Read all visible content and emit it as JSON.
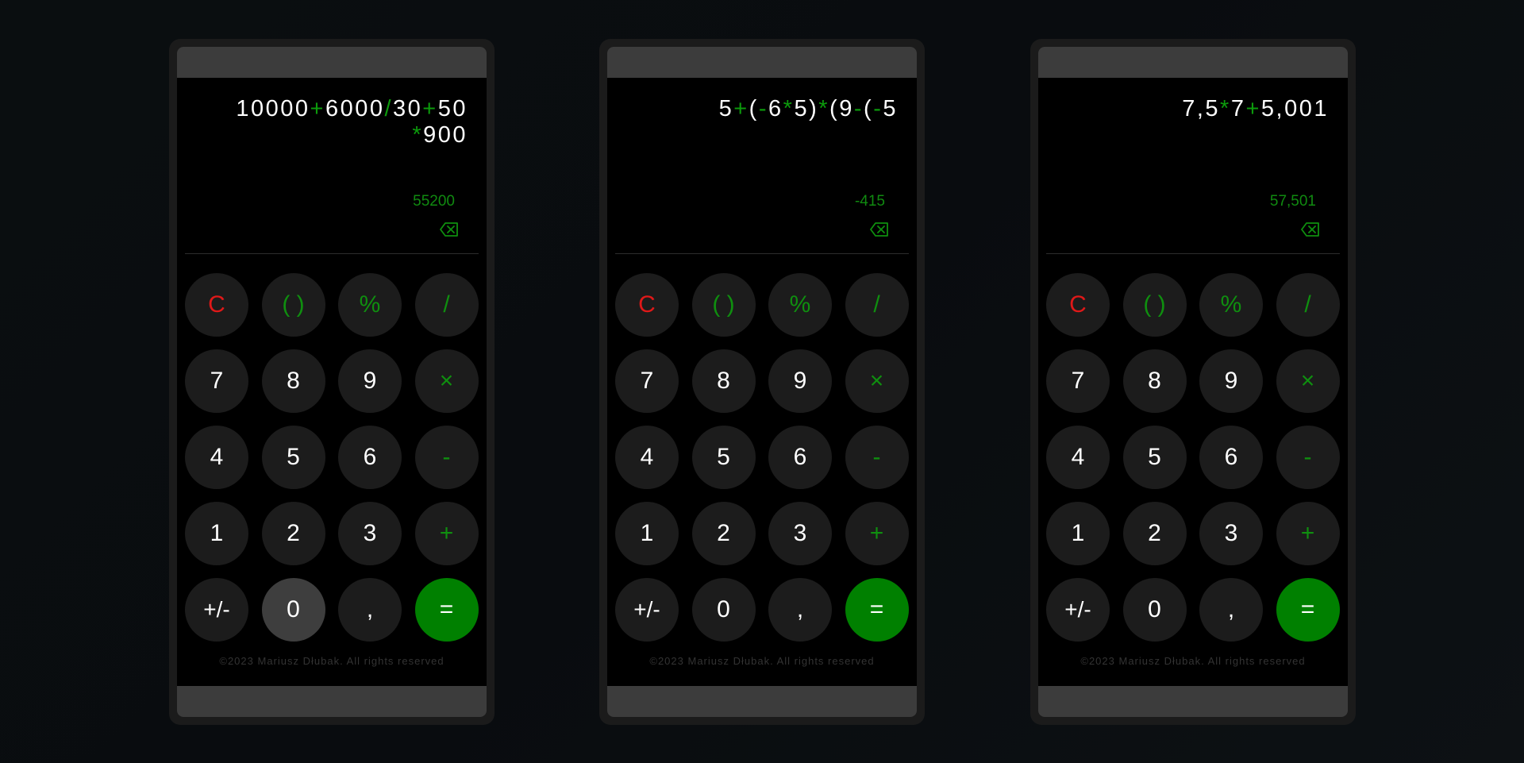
{
  "colors": {
    "background": "#0a0e10",
    "frame": "#1b1b1b",
    "screen": "#000000",
    "bar": "#3c3c3c",
    "key": "#1c1c1c",
    "key_pressed": "#3e3e3e",
    "accent_green": "#008000",
    "operator_green": "#0f8f0f",
    "clear_red": "#e01818",
    "footer_text": "#333333"
  },
  "calculators": [
    {
      "expression_tokens": [
        {
          "t": "10000",
          "op": false
        },
        {
          "t": "+",
          "op": true
        },
        {
          "t": "6000",
          "op": false
        },
        {
          "t": "/",
          "op": true
        },
        {
          "t": "30",
          "op": false
        },
        {
          "t": "+",
          "op": true
        },
        {
          "t": "50",
          "op": false
        },
        {
          "t": "*",
          "op": true
        },
        {
          "t": "900",
          "op": false
        }
      ],
      "result": "55200",
      "pressed_key": "0"
    },
    {
      "expression_tokens": [
        {
          "t": "5",
          "op": false
        },
        {
          "t": "+",
          "op": true
        },
        {
          "t": "(",
          "op": false
        },
        {
          "t": "-",
          "op": true
        },
        {
          "t": "6",
          "op": false
        },
        {
          "t": "*",
          "op": true
        },
        {
          "t": "5)",
          "op": false
        },
        {
          "t": "*",
          "op": true
        },
        {
          "t": "(9",
          "op": false
        },
        {
          "t": "-",
          "op": true
        },
        {
          "t": "(",
          "op": false
        },
        {
          "t": "-",
          "op": true
        },
        {
          "t": "5",
          "op": false
        }
      ],
      "result": "-415",
      "pressed_key": ""
    },
    {
      "expression_tokens": [
        {
          "t": "7,5",
          "op": false
        },
        {
          "t": "*",
          "op": true
        },
        {
          "t": "7",
          "op": false
        },
        {
          "t": "+",
          "op": true
        },
        {
          "t": "5,001",
          "op": false
        }
      ],
      "result": "57,501",
      "pressed_key": ""
    }
  ],
  "keys": [
    {
      "label": "C",
      "kind": "red",
      "name": "clear-button"
    },
    {
      "label": "( )",
      "kind": "green",
      "name": "parentheses-button"
    },
    {
      "label": "%",
      "kind": "green",
      "name": "percent-button"
    },
    {
      "label": "/",
      "kind": "green",
      "name": "divide-button"
    },
    {
      "label": "7",
      "kind": "digit",
      "name": "digit-7-button"
    },
    {
      "label": "8",
      "kind": "digit",
      "name": "digit-8-button"
    },
    {
      "label": "9",
      "kind": "digit",
      "name": "digit-9-button"
    },
    {
      "label": "×",
      "kind": "green",
      "name": "multiply-button"
    },
    {
      "label": "4",
      "kind": "digit",
      "name": "digit-4-button"
    },
    {
      "label": "5",
      "kind": "digit",
      "name": "digit-5-button"
    },
    {
      "label": "6",
      "kind": "digit",
      "name": "digit-6-button"
    },
    {
      "label": "-",
      "kind": "green",
      "name": "subtract-button"
    },
    {
      "label": "1",
      "kind": "digit",
      "name": "digit-1-button"
    },
    {
      "label": "2",
      "kind": "digit",
      "name": "digit-2-button"
    },
    {
      "label": "3",
      "kind": "digit",
      "name": "digit-3-button"
    },
    {
      "label": "+",
      "kind": "green",
      "name": "add-button"
    },
    {
      "label": "+/-",
      "kind": "digit",
      "name": "toggle-sign-button"
    },
    {
      "label": "0",
      "kind": "digit",
      "name": "digit-0-button"
    },
    {
      "label": ",",
      "kind": "digit",
      "name": "decimal-button"
    },
    {
      "label": "=",
      "kind": "equals",
      "name": "equals-button"
    }
  ],
  "backspace_icon": "backspace-icon",
  "footer": "©2023 Mariusz Dłubak. All rights reserved"
}
